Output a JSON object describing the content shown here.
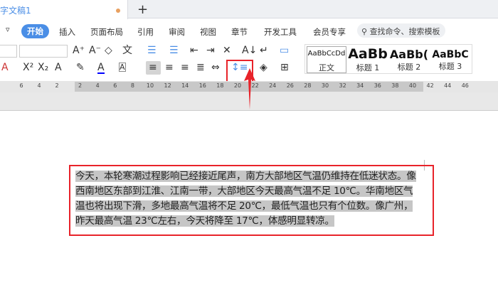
{
  "tab": {
    "title": "字文稿1",
    "new_tab": "+"
  },
  "menu": [
    "开始",
    "插入",
    "页面布局",
    "引用",
    "审阅",
    "视图",
    "章节",
    "开发工具",
    "会员专享"
  ],
  "search": {
    "placeholder": "查找命令、搜索模板"
  },
  "styles": [
    {
      "preview": "AaBbCcDd",
      "name": "正文"
    },
    {
      "preview": "AaBb",
      "name": "标题 1"
    },
    {
      "preview": "AaBb(",
      "name": "标题 2"
    },
    {
      "preview": "AaBbC",
      "name": "标题 3"
    }
  ],
  "ruler": [
    "6",
    "4",
    "2",
    "2",
    "4",
    "6",
    "8",
    "10",
    "12",
    "14",
    "16",
    "18",
    "20",
    "22",
    "24",
    "26",
    "28",
    "30",
    "32",
    "34",
    "36",
    "38",
    "40",
    "42",
    "44",
    "46"
  ],
  "document": {
    "paragraph": "今天，本轮寒潮过程影响已经接近尾声，南方大部地区气温仍维持在低迷状态。像西南地区东部到江淮、江南一带，大部地区今天最高气温不足 10℃。华南地区气温也将出现下滑，多地最高气温将不足 20℃，最低气温也只有个位数。像广州，昨天最高气温 23℃左右，今天将降至 17℃，体感明显转凉。"
  },
  "colors": {
    "accent": "#4a8ee6",
    "highlight": "#e8232a",
    "selection": "#c6c6c6"
  }
}
